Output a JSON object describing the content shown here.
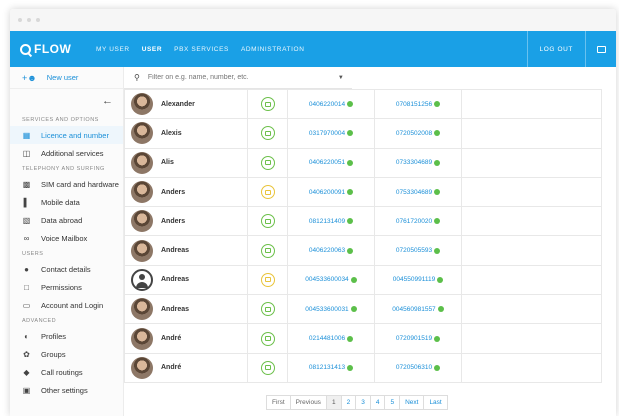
{
  "brand": {
    "name": "FLOW"
  },
  "nav": {
    "items": [
      {
        "label": "MY USER",
        "active": false
      },
      {
        "label": "USER",
        "active": true
      },
      {
        "label": "PBX SERVICES",
        "active": false
      },
      {
        "label": "ADMINISTRATION",
        "active": false
      }
    ],
    "logout": "LOG OUT"
  },
  "sidebar": {
    "new_user": "New user",
    "sections": [
      {
        "title": "SERVICES AND OPTIONS",
        "items": [
          {
            "label": "Licence and number",
            "icon": "licence-icon",
            "active": true
          },
          {
            "label": "Additional services",
            "icon": "services-icon",
            "active": false
          }
        ]
      },
      {
        "title": "TELEPHONY AND SURFING",
        "items": [
          {
            "label": "SIM card and hardware",
            "icon": "sim-card-icon",
            "active": false
          },
          {
            "label": "Mobile data",
            "icon": "bar-chart-icon",
            "active": false
          },
          {
            "label": "Data abroad",
            "icon": "phone-icon",
            "active": false
          },
          {
            "label": "Voice Mailbox",
            "icon": "voicemail-icon",
            "active": false
          }
        ]
      },
      {
        "title": "USERS",
        "items": [
          {
            "label": "Contact details",
            "icon": "person-icon",
            "active": false
          },
          {
            "label": "Permissions",
            "icon": "permissions-icon",
            "active": false
          },
          {
            "label": "Account and Login",
            "icon": "login-icon",
            "active": false
          }
        ]
      },
      {
        "title": "Advanced",
        "items": [
          {
            "label": "Profiles",
            "icon": "profile-icon",
            "active": false
          },
          {
            "label": "Groups",
            "icon": "groups-icon",
            "active": false
          },
          {
            "label": "Call routings",
            "icon": "routing-icon",
            "active": false
          },
          {
            "label": "Other settings",
            "icon": "settings-icon",
            "active": false
          }
        ]
      }
    ]
  },
  "search": {
    "placeholder": "Filter on e.g. name, number, etc."
  },
  "users": [
    {
      "name": "Alexander",
      "status": "green",
      "avatar": "photo",
      "num1": "0406220014",
      "num2": "0708151256"
    },
    {
      "name": "Alexis",
      "status": "green",
      "avatar": "photo",
      "num1": "0317970004",
      "num2": "0720502008"
    },
    {
      "name": "Alis",
      "status": "green",
      "avatar": "photo",
      "num1": "0406220051",
      "num2": "0733304689"
    },
    {
      "name": "Anders",
      "status": "yellow",
      "avatar": "photo",
      "num1": "0406200091",
      "num2": "0753304689"
    },
    {
      "name": "Anders",
      "status": "green",
      "avatar": "photo",
      "num1": "0812131409",
      "num2": "0761720020"
    },
    {
      "name": "Andreas",
      "status": "green",
      "avatar": "photo",
      "num1": "0406220063",
      "num2": "0720505593"
    },
    {
      "name": "Andreas",
      "status": "yellow",
      "avatar": "generic",
      "num1": "004533600034",
      "num2": "004550991119"
    },
    {
      "name": "Andreas",
      "status": "green",
      "avatar": "photo",
      "num1": "004533600031",
      "num2": "004560981557"
    },
    {
      "name": "André",
      "status": "green",
      "avatar": "photo",
      "num1": "0214481006",
      "num2": "0720901519"
    },
    {
      "name": "André",
      "status": "green",
      "avatar": "photo",
      "num1": "0812131413",
      "num2": "0720506310"
    }
  ],
  "pager": {
    "first": "First",
    "previous": "Previous",
    "pages": [
      "1",
      "2",
      "3",
      "4",
      "5"
    ],
    "current": "1",
    "next": "Next",
    "last": "Last"
  },
  "colors": {
    "accent": "#1aa0e6",
    "status_green": "#6cc04a",
    "status_yellow": "#e9c43a",
    "link": "#1a8fd8"
  }
}
